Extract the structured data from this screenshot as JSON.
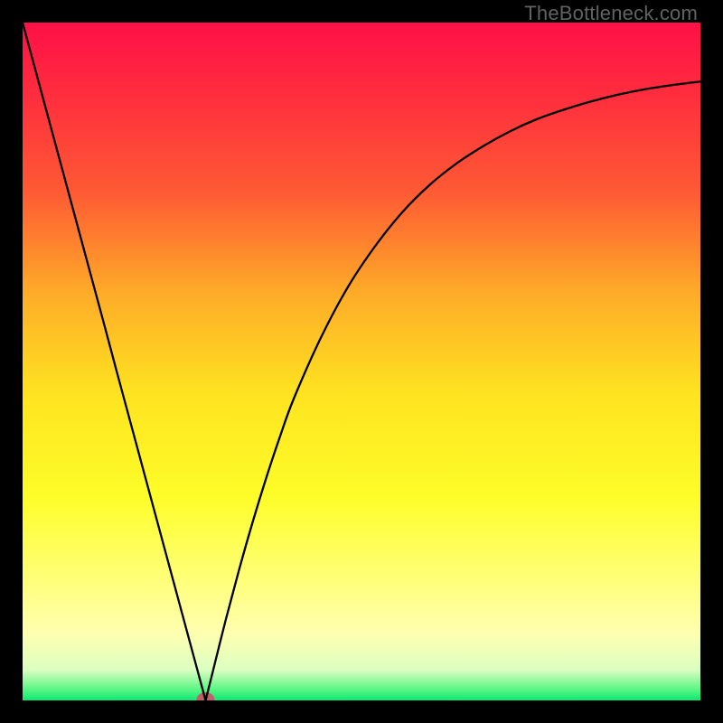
{
  "watermark": "TheBottleneck.com",
  "chart_data": {
    "type": "line",
    "title": "",
    "xlabel": "",
    "ylabel": "",
    "xlim": [
      0,
      100
    ],
    "ylim": [
      0,
      100
    ],
    "x": [
      0,
      2,
      4,
      6,
      8,
      10,
      12,
      14,
      16,
      18,
      20,
      22,
      24,
      26,
      27,
      28,
      30,
      32,
      34,
      36,
      38,
      40,
      44,
      48,
      52,
      56,
      60,
      64,
      68,
      72,
      76,
      80,
      84,
      88,
      92,
      96,
      100
    ],
    "values": [
      100,
      92.6,
      85.2,
      77.8,
      70.4,
      63.0,
      55.6,
      48.1,
      40.7,
      33.3,
      25.9,
      18.5,
      11.1,
      3.7,
      0.0,
      4.0,
      12.0,
      19.5,
      26.5,
      33.0,
      39.0,
      44.5,
      53.5,
      61.0,
      67.0,
      72.0,
      76.0,
      79.2,
      81.8,
      84.0,
      85.8,
      87.2,
      88.4,
      89.4,
      90.2,
      90.8,
      91.3
    ],
    "gradient_stops": [
      {
        "offset": 0.0,
        "color": "#ff1048"
      },
      {
        "offset": 0.1,
        "color": "#ff2b3e"
      },
      {
        "offset": 0.25,
        "color": "#fe5a34"
      },
      {
        "offset": 0.4,
        "color": "#feac28"
      },
      {
        "offset": 0.55,
        "color": "#fee420"
      },
      {
        "offset": 0.7,
        "color": "#fdfd29"
      },
      {
        "offset": 0.82,
        "color": "#ffff78"
      },
      {
        "offset": 0.9,
        "color": "#ffffb0"
      },
      {
        "offset": 0.955,
        "color": "#dcffc1"
      },
      {
        "offset": 0.985,
        "color": "#54f582"
      },
      {
        "offset": 1.0,
        "color": "#0ce874"
      }
    ],
    "marker": {
      "cx": 27,
      "cy": 0.2,
      "rx": 1.3,
      "ry": 1.0,
      "fill": "#c1606b"
    },
    "curve_color": "#000000",
    "curve_width": 2.3
  }
}
